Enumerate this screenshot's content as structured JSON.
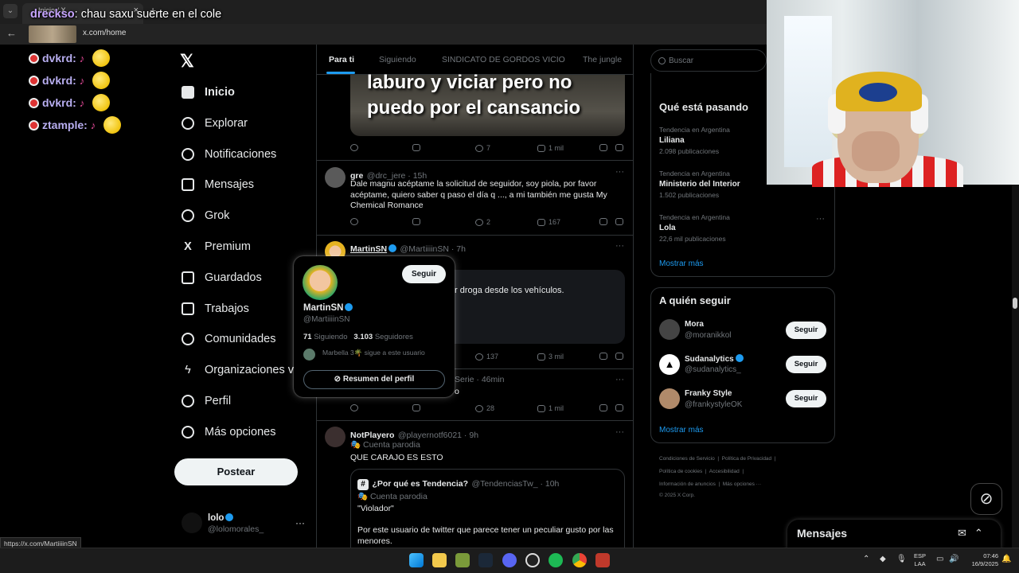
{
  "browser": {
    "tab_title": "Inicio / X",
    "tab_close": "×",
    "new_tab": "+",
    "url": "x.com/home",
    "status_url": "https://x.com/MartiiiinSN"
  },
  "overlay_chat": {
    "top_user": "drecksо",
    "top_message": "chau saxu suerte en el cole",
    "lines": [
      {
        "user": "dvkrd:"
      },
      {
        "user": "dvkrd:"
      },
      {
        "user": "dvkrd:"
      },
      {
        "user": "ztample:"
      }
    ]
  },
  "nav": {
    "items": [
      {
        "label": "Inicio"
      },
      {
        "label": "Explorar"
      },
      {
        "label": "Notificaciones"
      },
      {
        "label": "Mensajes"
      },
      {
        "label": "Grok"
      },
      {
        "label": "Premium"
      },
      {
        "label": "Guardados"
      },
      {
        "label": "Trabajos"
      },
      {
        "label": "Comunidades"
      },
      {
        "label": "Organizaciones v..."
      },
      {
        "label": "Perfil"
      },
      {
        "label": "Más opciones"
      }
    ],
    "post_button": "Postear",
    "account": {
      "name": "lolo",
      "handle": "@lolomorales_",
      "more": "···"
    }
  },
  "feed": {
    "tabs": [
      "Para ti",
      "Siguiendo",
      "SINDICATO DE GORDOS VICIO",
      "The jungle"
    ],
    "media_text": "laburo y viciar pero no puedo por el cansancio",
    "tweet0_actions": {
      "retweets": "",
      "likes": "7",
      "views": "1 mil"
    },
    "tweet1": {
      "name": "gre",
      "handle": "@drc_jere · 15h",
      "text": "Dale magnu acéptame la solicitud de seguidor,  soy piola, por favor acéptame, quiero saber q paso el día q ..., a mi también me gusta My Chemical Romance",
      "likes": "2",
      "views": "167"
    },
    "tweet2": {
      "name": "MartinSN",
      "handle": "@MartiiiinSN · 7h",
      "card_text": "r droga desde los vehículos.",
      "likes": "137",
      "views": "3 mil"
    },
    "tweet3": {
      "meta": "Serie · 46min",
      "text_tail": "o",
      "likes": "28",
      "views": "1 mil"
    },
    "tweet4": {
      "name": "NotPlayero",
      "handle": "@playernotf6021 · 9h",
      "tag": "Cuenta parodia",
      "text": "QUE CARAJO ES ESTO",
      "quote": {
        "name": "¿Por qué es Tendencia?",
        "handle": "@TendenciasTw_ · 10h",
        "tag": "Cuenta parodia",
        "text1": "\"Violador\"",
        "text2": "Por este usuario de twitter que parece tener un peculiar gusto por las menores."
      }
    }
  },
  "hovercard": {
    "follow": "Seguir",
    "name": "MartinSN",
    "handle": "@MartiiiinSN",
    "following_count": "71",
    "following_label": "Siguiendo",
    "followers_count": "3.103",
    "followers_label": "Seguidores",
    "followed_by": "Marbella 3🌴 sigue a este usuario",
    "summary_button": "Resumen del perfil"
  },
  "sidebar": {
    "search_placeholder": "Buscar",
    "trends_title": "Qué está pasando",
    "trends": [
      {
        "category": "Tendencia en Argentina",
        "name": "Liliana",
        "count": "2.098 publicaciones"
      },
      {
        "category": "Tendencia en Argentina",
        "name": "Ministerio del Interior",
        "count": "1.502 publicaciones"
      },
      {
        "category": "Tendencia en Argentina",
        "name": "Lola",
        "count": "22,6 mil publicaciones"
      }
    ],
    "show_more": "Mostrar más",
    "who_title": "A quién seguir",
    "who": [
      {
        "name": "Mora",
        "handle": "@moranikkol",
        "button": "Seguir"
      },
      {
        "name": "Sudanalytics",
        "handle": "@sudanalytics_",
        "button": "Seguir"
      },
      {
        "name": "Franky Style",
        "handle": "@frankystyleOK",
        "button": "Seguir"
      }
    ],
    "footer": {
      "line1a": "Condiciones de Servicio",
      "line1b": "Política de Privacidad",
      "line2a": "Política de cookies",
      "line2b": "Accesibilidad",
      "line3a": "Información de anuncios",
      "line3b": "Más opciones ···",
      "line4": "© 2025 X Corp."
    }
  },
  "messages": {
    "title": "Mensajes"
  },
  "taskbar": {
    "lang1": "ESP",
    "lang2": "LAA",
    "time": "07:46",
    "date": "16/9/2025"
  }
}
